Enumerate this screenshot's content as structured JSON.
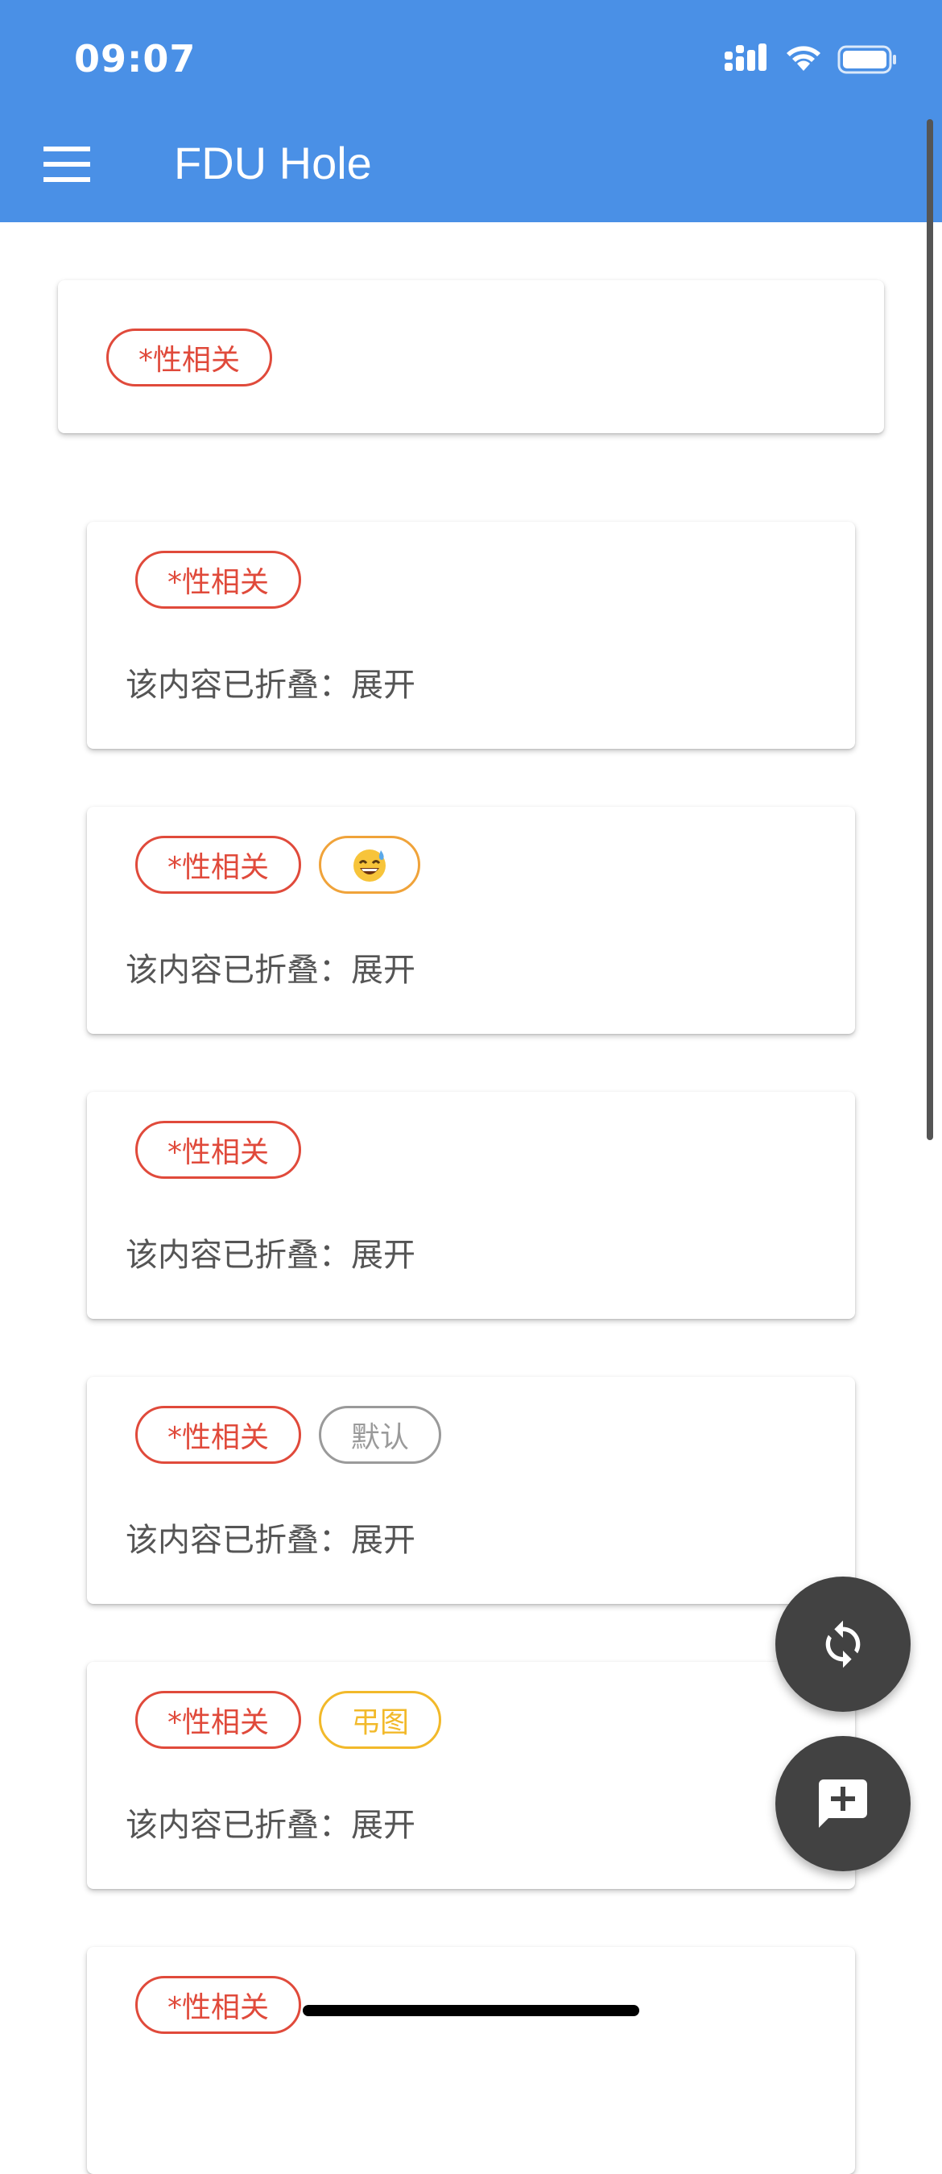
{
  "status_bar": {
    "time": "09:07"
  },
  "app_bar": {
    "title": "FDU Hole",
    "menu_icon": "menu-icon"
  },
  "filter_card": {
    "tag": "*性相关"
  },
  "posts": [
    {
      "tags": [
        "*性相关"
      ],
      "collapsed_text": "该内容已折叠：展开"
    },
    {
      "tags": [
        "*性相关",
        "😅"
      ],
      "collapsed_text": "该内容已折叠：展开"
    },
    {
      "tags": [
        "*性相关"
      ],
      "collapsed_text": "该内容已折叠：展开"
    },
    {
      "tags": [
        "*性相关",
        "默认"
      ],
      "collapsed_text": "该内容已折叠：展开"
    },
    {
      "tags": [
        "*性相关",
        "弔图"
      ],
      "collapsed_text": "该内容已折叠：展开"
    },
    {
      "tags": [
        "*性相关"
      ],
      "collapsed_text": ""
    }
  ],
  "fabs": {
    "refresh_icon": "refresh-icon",
    "new_post_icon": "add-comment-icon"
  },
  "colors": {
    "app_bar": "#4a90e6",
    "tag_sex": "#e04a3b",
    "tag_emoji": "#f0a33a",
    "tag_default": "#9a9a9a",
    "tag_pic": "#f2b92a",
    "fab": "#424242"
  }
}
